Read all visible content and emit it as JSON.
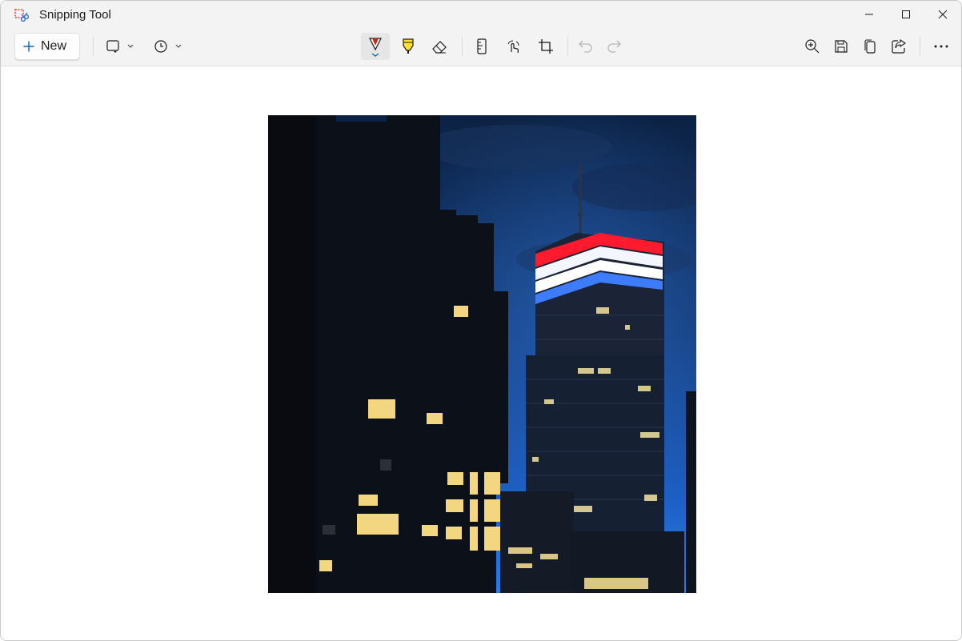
{
  "window": {
    "title": "Snipping Tool",
    "controls": [
      "minimize",
      "maximize",
      "close"
    ]
  },
  "toolbar": {
    "new_label": "New",
    "snip_mode_icon": "rectangle-snip-icon",
    "delay_icon": "clock-icon",
    "tools": [
      {
        "name": "ballpoint-pen",
        "active": true
      },
      {
        "name": "highlighter",
        "active": false
      },
      {
        "name": "eraser",
        "active": false
      },
      {
        "name": "ruler",
        "active": false
      },
      {
        "name": "touch-writing",
        "active": false
      },
      {
        "name": "crop",
        "active": false
      },
      {
        "name": "undo",
        "enabled": false
      },
      {
        "name": "redo",
        "enabled": false
      }
    ],
    "right_actions": [
      "zoom-in",
      "save",
      "copy",
      "share",
      "more-options"
    ]
  },
  "colors": {
    "chrome_bg": "#f3f3f3",
    "canvas_bg": "#ffffff",
    "accent": "#0067c0",
    "pen_red": "#c42b1c",
    "highlighter_yellow": "#ffe135",
    "stripe_red": "#ff1a2e",
    "stripe_white": "#f4f6ff",
    "stripe_blue": "#3d7bff"
  },
  "snip": {
    "content": "photo-night-skyline"
  }
}
